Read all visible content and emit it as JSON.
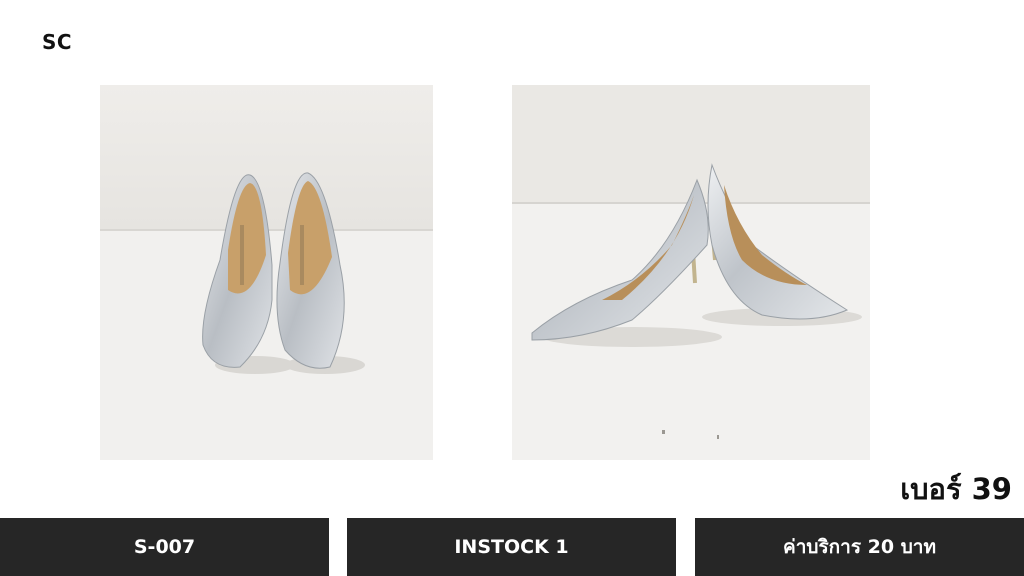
{
  "brand": "SC",
  "photos": [
    {
      "subject": "silver pointed-toe pumps, front view"
    },
    {
      "subject": "silver pointed-toe pumps, side view"
    }
  ],
  "size_label": "เบอร์ 39",
  "info_bar": {
    "code": "S-007",
    "stock": "INSTOCK 1",
    "fee": "ค่าบริการ 20 บาท"
  },
  "colors": {
    "bar_background": "#262626",
    "bar_text": "#ffffff",
    "shoe_silver": "#c9cdd2"
  }
}
